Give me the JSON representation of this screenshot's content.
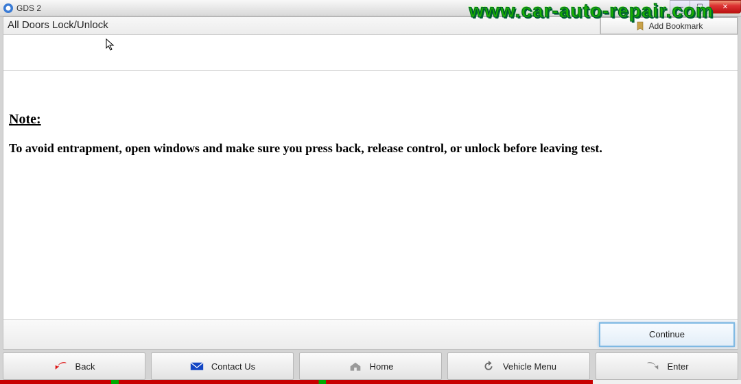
{
  "window": {
    "title": "GDS 2"
  },
  "watermark": "www.car-auto-repair.com",
  "header": {
    "page_title": "All Doors Lock/Unlock",
    "bookmark_label": "Add Bookmark"
  },
  "content": {
    "note_label": "Note:",
    "note_body": "To avoid entrapment, open windows and make sure you press back, release control, or unlock before leaving test."
  },
  "actions": {
    "continue_label": "Continue"
  },
  "toolbar": {
    "back": "Back",
    "contact": "Contact Us",
    "home": "Home",
    "vehicle_menu": "Vehicle Menu",
    "enter": "Enter"
  }
}
